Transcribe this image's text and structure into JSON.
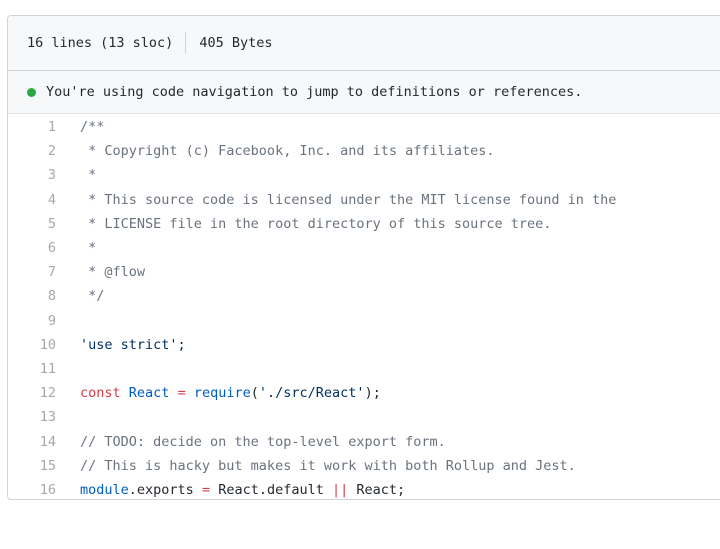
{
  "header": {
    "lines_info": "16 lines (13 sloc)",
    "size_info": "405 Bytes"
  },
  "banner": {
    "status_color": "#28a745",
    "text": "You're using code navigation to jump to definitions or references."
  },
  "code": {
    "lines": [
      {
        "n": "1",
        "tokens": [
          {
            "t": "/**",
            "c": "c"
          }
        ]
      },
      {
        "n": "2",
        "tokens": [
          {
            "t": " * Copyright (c) Facebook, Inc. and its affiliates.",
            "c": "c"
          }
        ]
      },
      {
        "n": "3",
        "tokens": [
          {
            "t": " *",
            "c": "c"
          }
        ]
      },
      {
        "n": "4",
        "tokens": [
          {
            "t": " * This source code is licensed under the MIT license found in the",
            "c": "c"
          }
        ]
      },
      {
        "n": "5",
        "tokens": [
          {
            "t": " * LICENSE file in the root directory of this source tree.",
            "c": "c"
          }
        ]
      },
      {
        "n": "6",
        "tokens": [
          {
            "t": " *",
            "c": "c"
          }
        ]
      },
      {
        "n": "7",
        "tokens": [
          {
            "t": " * @flow",
            "c": "c"
          }
        ]
      },
      {
        "n": "8",
        "tokens": [
          {
            "t": " */",
            "c": "c"
          }
        ]
      },
      {
        "n": "9",
        "tokens": []
      },
      {
        "n": "10",
        "tokens": [
          {
            "t": "'use strict';",
            "c": "s"
          }
        ]
      },
      {
        "n": "11",
        "tokens": []
      },
      {
        "n": "12",
        "tokens": [
          {
            "t": "const",
            "c": "k"
          },
          {
            "t": " ",
            "c": ""
          },
          {
            "t": "React",
            "c": "e"
          },
          {
            "t": " ",
            "c": ""
          },
          {
            "t": "=",
            "c": "k"
          },
          {
            "t": " ",
            "c": ""
          },
          {
            "t": "require",
            "c": "e"
          },
          {
            "t": "(",
            "c": ""
          },
          {
            "t": "'./src/React'",
            "c": "s"
          },
          {
            "t": ");",
            "c": ""
          }
        ]
      },
      {
        "n": "13",
        "tokens": []
      },
      {
        "n": "14",
        "tokens": [
          {
            "t": "// TODO: decide on the top-level export form.",
            "c": "c"
          }
        ]
      },
      {
        "n": "15",
        "tokens": [
          {
            "t": "// This is hacky but makes it work with both Rollup and Jest.",
            "c": "c"
          }
        ]
      },
      {
        "n": "16",
        "tokens": [
          {
            "t": "module",
            "c": "e"
          },
          {
            "t": ".exports ",
            "c": ""
          },
          {
            "t": "=",
            "c": "k"
          },
          {
            "t": " React.default ",
            "c": ""
          },
          {
            "t": "||",
            "c": "k"
          },
          {
            "t": " React;",
            "c": ""
          }
        ]
      }
    ]
  }
}
